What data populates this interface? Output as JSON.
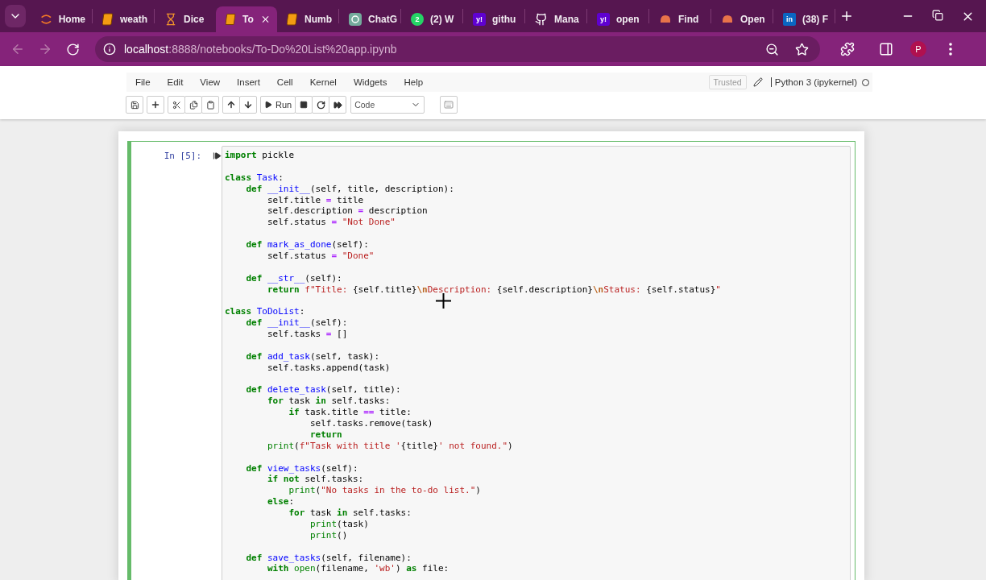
{
  "browser": {
    "tabs": [
      {
        "label": "Home",
        "kind": "jupyter",
        "selected": false
      },
      {
        "label": "weath",
        "kind": "notebook",
        "selected": false
      },
      {
        "label": "Dice",
        "kind": "hourglass",
        "selected": false
      },
      {
        "label": "To",
        "kind": "notebook",
        "selected": true
      },
      {
        "label": "Numb",
        "kind": "notebook",
        "selected": false
      },
      {
        "label": "ChatG",
        "kind": "chatgpt",
        "selected": false
      },
      {
        "label": "(2) W",
        "kind": "whatsapp",
        "icon_text": "2",
        "selected": false
      },
      {
        "label": "githu",
        "kind": "yahoo",
        "icon_text": "y!",
        "selected": false
      },
      {
        "label": "Mana",
        "kind": "github",
        "selected": false
      },
      {
        "label": "open",
        "kind": "yahoo",
        "icon_text": "y!",
        "selected": false
      },
      {
        "label": "Find",
        "kind": "blob",
        "selected": false
      },
      {
        "label": "Open",
        "kind": "blob",
        "selected": false
      },
      {
        "label": "(38) F",
        "kind": "linkedin",
        "icon_text": "in",
        "selected": false
      }
    ],
    "back_disabled": true,
    "forward_disabled": true,
    "url_host": "localhost",
    "url_rest": ":8888/notebooks/To-Do%20List%20app.ipynb",
    "avatar": "P"
  },
  "notebook": {
    "menu": [
      "File",
      "Edit",
      "View",
      "Insert",
      "Cell",
      "Kernel",
      "Widgets",
      "Help"
    ],
    "trusted": "Trusted",
    "kernel": "Python 3 (ipykernel)",
    "kernel_busy": false,
    "run_label": "Run",
    "cell_type": "Code",
    "cell": {
      "prompt": "In [5]:",
      "selected": true,
      "lines": [
        {
          "tokens": [
            {
              "kind": "kw",
              "text": "import"
            },
            {
              "kind": "p",
              "text": " pickle"
            }
          ]
        },
        {
          "blank_before": true,
          "tokens": [
            {
              "kind": "kw",
              "text": "class"
            },
            {
              "kind": "name",
              "text": " Task"
            },
            {
              "kind": "p",
              "text": ":"
            }
          ]
        },
        {
          "tokens": [
            {
              "kind": "kw",
              "text": "    def"
            },
            {
              "kind": "name",
              "text": " __init__"
            },
            {
              "kind": "p",
              "text": "(self, title, description):"
            }
          ]
        },
        {
          "tokens": [
            {
              "kind": "p",
              "text": "        self.title"
            },
            {
              "kind": "op",
              "text": " ="
            },
            {
              "kind": "p",
              "text": " title"
            }
          ]
        },
        {
          "tokens": [
            {
              "kind": "p",
              "text": "        self.description"
            },
            {
              "kind": "op",
              "text": " ="
            },
            {
              "kind": "p",
              "text": " description"
            }
          ]
        },
        {
          "tokens": [
            {
              "kind": "p",
              "text": "        self.status"
            },
            {
              "kind": "op",
              "text": " ="
            },
            {
              "kind": "str",
              "text": " \"Not Done\""
            }
          ]
        },
        {
          "blank_before": true,
          "tokens": [
            {
              "kind": "kw",
              "text": "    def"
            },
            {
              "kind": "name",
              "text": " mark_as_done"
            },
            {
              "kind": "p",
              "text": "(self):"
            }
          ]
        },
        {
          "tokens": [
            {
              "kind": "p",
              "text": "        self.status"
            },
            {
              "kind": "op",
              "text": " ="
            },
            {
              "kind": "str",
              "text": " \"Done\""
            }
          ]
        },
        {
          "blank_before": true,
          "tokens": [
            {
              "kind": "kw",
              "text": "    def"
            },
            {
              "kind": "name",
              "text": " __str__"
            },
            {
              "kind": "p",
              "text": "(self):"
            }
          ]
        },
        {
          "tokens": [
            {
              "kind": "kw",
              "text": "        return"
            },
            {
              "kind": "str",
              "text": " f\"Title: "
            },
            {
              "kind": "p",
              "text": "{self.title}"
            },
            {
              "kind": "esc",
              "text": "\\n"
            },
            {
              "kind": "str",
              "text": "Description: "
            },
            {
              "kind": "p",
              "text": "{self.description}"
            },
            {
              "kind": "esc",
              "text": "\\n"
            },
            {
              "kind": "str",
              "text": "Status: "
            },
            {
              "kind": "p",
              "text": "{self.status}"
            },
            {
              "kind": "str",
              "text": "\""
            }
          ]
        },
        {
          "blank_before": true,
          "tokens": [
            {
              "kind": "kw",
              "text": "class"
            },
            {
              "kind": "name",
              "text": " ToDoList"
            },
            {
              "kind": "p",
              "text": ":"
            }
          ]
        },
        {
          "tokens": [
            {
              "kind": "kw",
              "text": "    def"
            },
            {
              "kind": "name",
              "text": " __init__"
            },
            {
              "kind": "p",
              "text": "(self):"
            }
          ]
        },
        {
          "tokens": [
            {
              "kind": "p",
              "text": "        self.tasks"
            },
            {
              "kind": "op",
              "text": " ="
            },
            {
              "kind": "p",
              "text": " []"
            }
          ]
        },
        {
          "blank_before": true,
          "tokens": [
            {
              "kind": "kw",
              "text": "    def"
            },
            {
              "kind": "name",
              "text": " add_task"
            },
            {
              "kind": "p",
              "text": "(self, task):"
            }
          ]
        },
        {
          "tokens": [
            {
              "kind": "p",
              "text": "        self.tasks.append(task)"
            }
          ]
        },
        {
          "blank_before": true,
          "tokens": [
            {
              "kind": "kw",
              "text": "    def"
            },
            {
              "kind": "name",
              "text": " delete_task"
            },
            {
              "kind": "p",
              "text": "(self, title):"
            }
          ]
        },
        {
          "tokens": [
            {
              "kind": "kw",
              "text": "        for"
            },
            {
              "kind": "p",
              "text": " task"
            },
            {
              "kind": "kw",
              "text": " in"
            },
            {
              "kind": "p",
              "text": " self.tasks:"
            }
          ]
        },
        {
          "tokens": [
            {
              "kind": "kw",
              "text": "            if"
            },
            {
              "kind": "p",
              "text": " task.title"
            },
            {
              "kind": "op",
              "text": " =="
            },
            {
              "kind": "p",
              "text": " title:"
            }
          ]
        },
        {
          "tokens": [
            {
              "kind": "p",
              "text": "                self.tasks.remove(task)"
            }
          ]
        },
        {
          "tokens": [
            {
              "kind": "kw",
              "text": "                return"
            }
          ]
        },
        {
          "tokens": [
            {
              "kind": "bi",
              "text": "        print"
            },
            {
              "kind": "p",
              "text": "("
            },
            {
              "kind": "str",
              "text": "f\"Task with title '"
            },
            {
              "kind": "p",
              "text": "{title}"
            },
            {
              "kind": "str",
              "text": "' not found.\""
            },
            {
              "kind": "p",
              "text": ")"
            }
          ]
        },
        {
          "blank_before": true,
          "tokens": [
            {
              "kind": "kw",
              "text": "    def"
            },
            {
              "kind": "name",
              "text": " view_tasks"
            },
            {
              "kind": "p",
              "text": "(self):"
            }
          ]
        },
        {
          "tokens": [
            {
              "kind": "kw",
              "text": "        if"
            },
            {
              "kind": "kw",
              "text": " not"
            },
            {
              "kind": "p",
              "text": " self.tasks:"
            }
          ]
        },
        {
          "tokens": [
            {
              "kind": "bi",
              "text": "            print"
            },
            {
              "kind": "p",
              "text": "("
            },
            {
              "kind": "str",
              "text": "\"No tasks in the to-do list.\""
            },
            {
              "kind": "p",
              "text": ")"
            }
          ]
        },
        {
          "tokens": [
            {
              "kind": "kw",
              "text": "        else"
            },
            {
              "kind": "p",
              "text": ":"
            }
          ]
        },
        {
          "tokens": [
            {
              "kind": "kw",
              "text": "            for"
            },
            {
              "kind": "p",
              "text": " task"
            },
            {
              "kind": "kw",
              "text": " in"
            },
            {
              "kind": "p",
              "text": " self.tasks:"
            }
          ]
        },
        {
          "tokens": [
            {
              "kind": "bi",
              "text": "                print"
            },
            {
              "kind": "p",
              "text": "(task)"
            }
          ]
        },
        {
          "tokens": [
            {
              "kind": "bi",
              "text": "                print"
            },
            {
              "kind": "p",
              "text": "()"
            }
          ]
        },
        {
          "blank_before": true,
          "tokens": [
            {
              "kind": "kw",
              "text": "    def"
            },
            {
              "kind": "name",
              "text": " save_tasks"
            },
            {
              "kind": "p",
              "text": "(self, filename):"
            }
          ]
        },
        {
          "tokens": [
            {
              "kind": "kw",
              "text": "        with"
            },
            {
              "kind": "bi",
              "text": " open"
            },
            {
              "kind": "p",
              "text": "(filename, "
            },
            {
              "kind": "str",
              "text": "'wb'"
            },
            {
              "kind": "p",
              "text": ")"
            },
            {
              "kind": "kw",
              "text": " as"
            },
            {
              "kind": "p",
              "text": " file:"
            }
          ]
        }
      ]
    }
  }
}
